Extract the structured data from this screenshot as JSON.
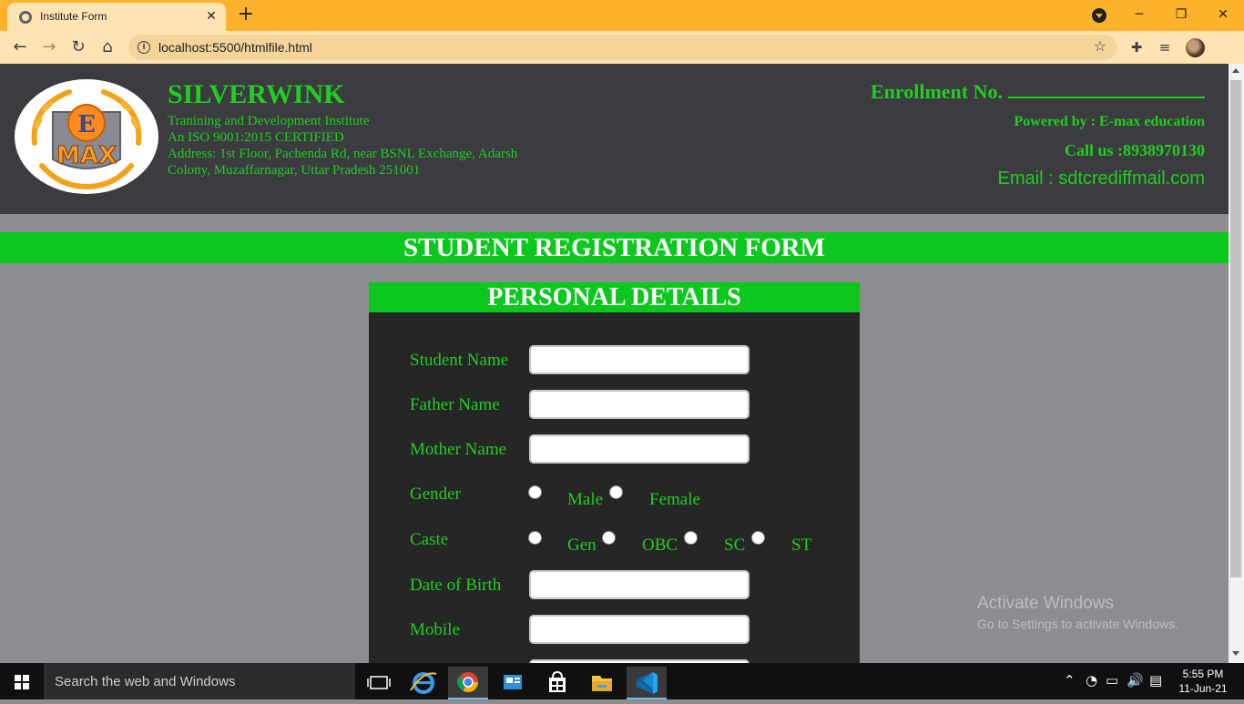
{
  "browser": {
    "tab_title": "Institute Form",
    "tab_close": "✕",
    "new_tab": "+",
    "url": "localhost:5500/htmlfile.html",
    "window_controls": {
      "minimize": "─",
      "restore": "❐",
      "close": "✕"
    },
    "nav": {
      "back": "←",
      "forward": "→",
      "reload": "↻",
      "home": "⌂"
    },
    "info_glyph": "i",
    "star_glyph": "☆",
    "extensions_glyph": "✚",
    "media_glyph": "≡"
  },
  "header": {
    "logo_top": "E",
    "logo_bottom": "MAX",
    "institute_name": "SILVERWINK",
    "tagline": "Tranining and Development Institute",
    "certification": "An ISO 9001:2015 CERTIFIED",
    "address": "Address: 1st Floor, Pachenda Rd, near BSNL Exchange, Adarsh Colony, Muzaffarnagar, Uttar Pradesh 251001",
    "enrollment_label": "Enrollment No.",
    "powered_by": "Powered by : E-max education",
    "call_us": "Call us :8938970130",
    "email": "Email : sdtcrediffmail.com"
  },
  "form": {
    "title": "STUDENT REGISTRATION FORM",
    "section_title": "PERSONAL DETAILS",
    "labels": {
      "student_name": "Student Name",
      "father_name": "Father Name",
      "mother_name": "Mother Name",
      "gender": "Gender",
      "caste": "Caste",
      "dob": "Date of Birth",
      "mobile": "Mobile"
    },
    "gender_options": [
      "Male",
      "Female"
    ],
    "caste_options": [
      "Gen",
      "OBC",
      "SC",
      "ST"
    ]
  },
  "watermark": {
    "line1": "Activate Windows",
    "line2": "Go to Settings to activate Windows."
  },
  "taskbar": {
    "search_placeholder": "Search the web and Windows",
    "time": "5:55 PM",
    "date": "11-Jun-21"
  },
  "colors": {
    "accent_green": "#1fcf1f",
    "banner_green": "#0cc81e",
    "header_bg": "#3b3b40",
    "chrome_orange": "#fdb22b"
  }
}
